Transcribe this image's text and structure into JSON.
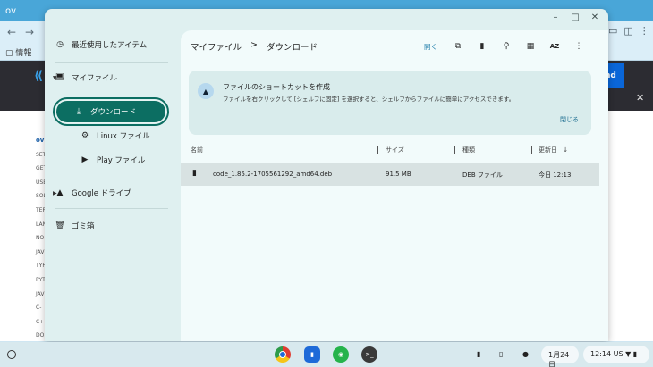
{
  "background_browser": {
    "tab_title": "ov",
    "bookmark_label": "情報",
    "banner_button": "nd",
    "sidenav": [
      "ov",
      "SET",
      "GET",
      "USE",
      "SOL",
      "TER",
      "LAN",
      "NO",
      "JAV",
      "TYF",
      "PYT",
      "JAV",
      "C-",
      "C++",
      "DO"
    ]
  },
  "files_app": {
    "window_controls": {
      "minimize": "–",
      "maximize": "□",
      "close": "✕"
    },
    "sidebar": {
      "recent": "最近使用したアイテム",
      "my_files": "マイファイル",
      "downloads": "ダウンロード",
      "linux_files": "Linux ファイル",
      "play_files": "Play ファイル",
      "google_drive": "Google ドライブ",
      "trash": "ゴミ箱"
    },
    "breadcrumb": {
      "root": "マイファイル",
      "separator": ">",
      "current": "ダウンロード"
    },
    "toolbar": {
      "open": "開く",
      "sort_label": "AZ"
    },
    "banner": {
      "title": "ファイルのショートカットを作成",
      "description": "ファイルを右クリックして [シェルフに固定] を選択すると、シェルフからファイルに簡単にアクセスできます。",
      "close": "閉じる"
    },
    "columns": {
      "name": "名前",
      "size": "サイズ",
      "type": "種類",
      "modified": "更新日",
      "sort_indicator": "↓"
    },
    "files": [
      {
        "name": "code_1.85.2-1705561292_amd64.deb",
        "size": "91.5 MB",
        "type": "DEB ファイル",
        "modified": "今日 12:13"
      }
    ]
  },
  "shelf": {
    "date": "1月24日",
    "time": "12:14",
    "ime": "US",
    "terminal_glyph": ">_"
  }
}
